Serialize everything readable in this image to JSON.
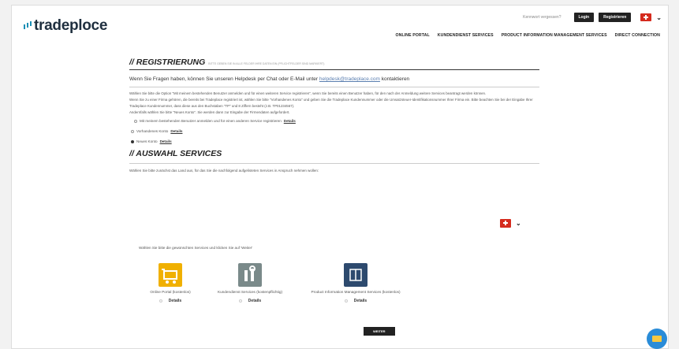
{
  "brand": {
    "logo_text": "tradeploce"
  },
  "topbar": {
    "forgot": "Kennwort vergessen?",
    "login": "Login",
    "register": "Registrieren"
  },
  "nav": [
    "ONLINE PORTAL",
    "KUNDENDIENST SERVICES",
    "PRODUCT INFORMATION MANAGEMENT SERVICES",
    "DIRECT CONNECTION"
  ],
  "registration": {
    "title": "// REGISTRIERUNG",
    "title_small": "BITTE GEBEN SIE IN ALLE FELDER IHRE DATEN EIN (PFLICHTFELDER SIND MARKIERT)",
    "help_prefix": "Wenn Sie Fragen haben, können Sie unseren Helpdesk per Chat oder E-Mail unter ",
    "help_email": "helpdesk@tradeplace.com",
    "help_suffix": " kontaktieren",
    "para1": "Wählen Sie bitte die Option \"Mit meinem bestehenden Benutzer anmelden und für einen weiteren Service registrieren\", wenn Sie bereits einen Benutzer haben, für den nach der Anmeldung weitere Services beantragt werden können.",
    "para2": "Wenn Sie zu einer Firma gehören, die bereits bei Tradeplace registriert ist, wählen Sie bitte \"Vorhandenes Konto\" und geben Sie die Tradeplace Kundennummer oder die Umsatzsteuer-Identifikationsnummer Ihrer Firma ein. Bitte beachten Sie bei der Eingabe Ihrer Tradeplace Kundennummer, dass diese aus den Buchstaben \"TP\" und 8 Ziffern besteht (z.B. TP01234567).",
    "para3": "Andernfalls wählen Sie bitte \"Neues Konto\". Sie werden dann zur Eingabe der Firmendaten aufgefordert.",
    "options": [
      {
        "label": "Mit meinem bestehenden Benutzer anmelden und für einen anderen Service registrieren",
        "details": "Details"
      },
      {
        "label": "Vorhandenes Konto",
        "details": "Details"
      },
      {
        "label": "Neues Konto",
        "details": "Details"
      }
    ]
  },
  "services": {
    "title": "// AUSWAHL SERVICES",
    "country_hint": "Wählen Sie bitte zunächst das Land aus, für das Sie die nachfolgend aufgelisteten Services in Anspruch nehmen wollen:",
    "choose_hint": "Wählen Sie bitte die gewünschten Services und klicken Sie auf 'Weiter'",
    "items": [
      {
        "label": "Online Portal (kostenlos)",
        "details": "Details",
        "color": "#f0b000"
      },
      {
        "label": "Kundendienst Services (kostenpflichtig)",
        "details": "Details",
        "color": "#7a8a8a"
      },
      {
        "label": "Product Information Management Services (kostenlos)",
        "details": "Details",
        "color": "#2d4a6e"
      }
    ],
    "next": "WEITER"
  }
}
